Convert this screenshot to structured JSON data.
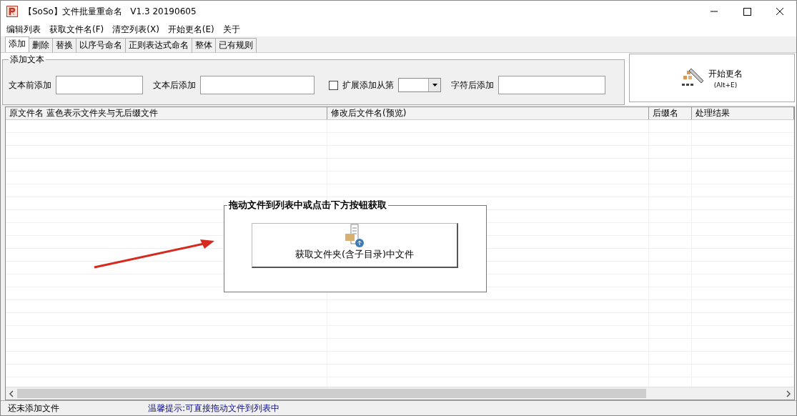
{
  "window": {
    "title": "【SoSo】文件批量重命名   V1.3 20190605"
  },
  "menu": [
    "编辑列表",
    "获取文件名(F)",
    "清空列表(X)",
    "开始更名(E)",
    "关于"
  ],
  "tabs": [
    {
      "label": "添加",
      "selected": true
    },
    {
      "label": "删除",
      "selected": false
    },
    {
      "label": "替换",
      "selected": false
    },
    {
      "label": "以序号命名",
      "selected": false
    },
    {
      "label": "正则表达式命名",
      "selected": false
    },
    {
      "label": "整体",
      "selected": false
    },
    {
      "label": "已有规则",
      "selected": false
    }
  ],
  "add_text_group": {
    "legend": "添加文本",
    "before_label": "文本前添加",
    "after_label": "文本后添加",
    "extend": {
      "label": "扩展添加从第",
      "checked": false
    },
    "char_after_label": "字符后添加"
  },
  "start_button": {
    "label": "开始更名",
    "shortcut": "(Alt+E)"
  },
  "table": {
    "columns": [
      "原文件名  蓝色表示文件夹与无后缀文件",
      "修改后文件名(预览)",
      "后缀名",
      "处理结果"
    ]
  },
  "drop_panel": {
    "title": "拖动文件到列表中或点击下方按钮获取",
    "button": "获取文件夹(含子目录)中文件"
  },
  "status_bar": {
    "left": "还未添加文件",
    "tip": "温馨提示:可直接拖动文件到列表中"
  }
}
